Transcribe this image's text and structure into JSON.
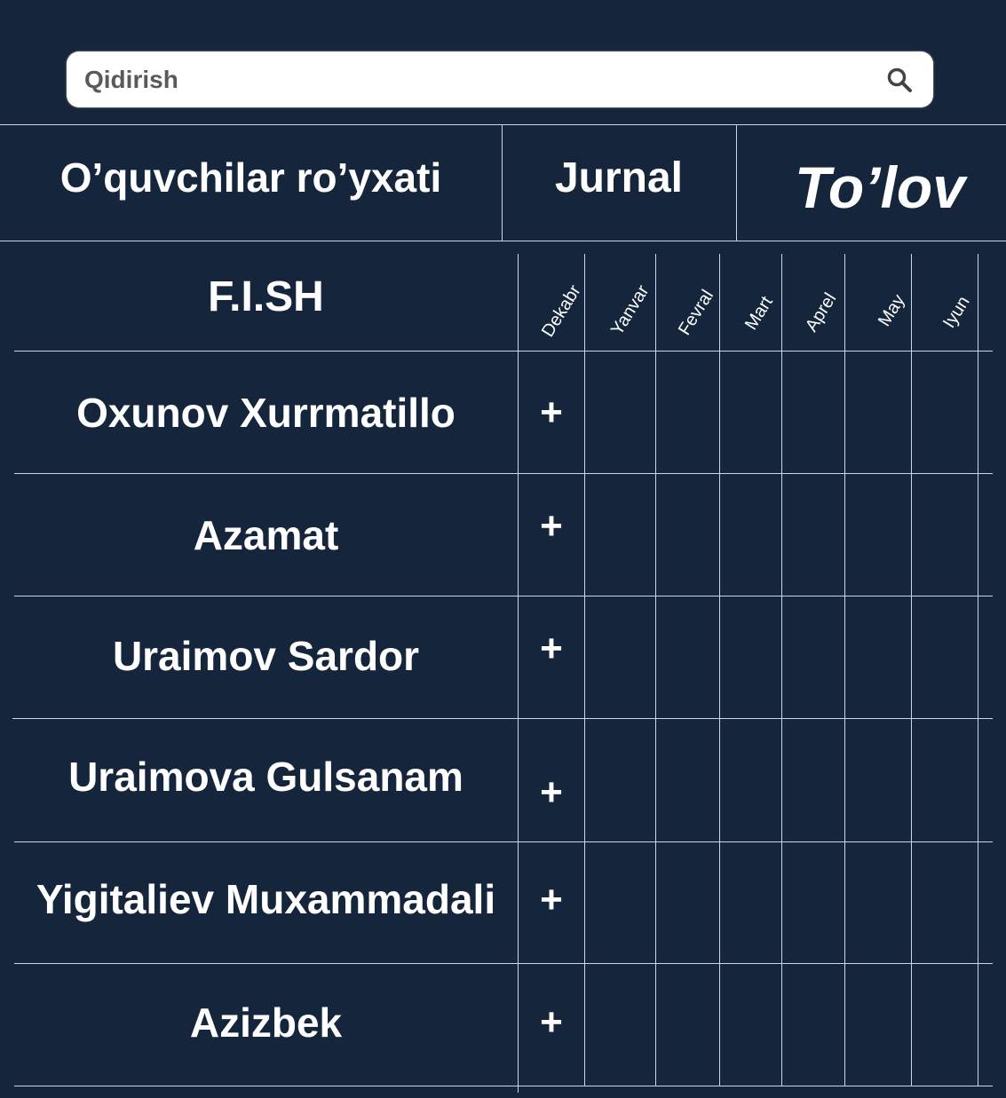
{
  "search": {
    "placeholder": "Qidirish",
    "icon": "search-icon"
  },
  "tabs": {
    "students": "O’quvchilar ro’yxati",
    "journal": "Jurnal",
    "payment": "To’lov"
  },
  "table": {
    "name_header": "F.I.SH",
    "months": [
      "Dekabr",
      "Yanvar",
      "Fevral",
      "Mart",
      "Aprel",
      "May",
      "Iyun"
    ],
    "rows": [
      {
        "name": "Oxunov Xurrmatillo",
        "dekabr": "+"
      },
      {
        "name": "Azamat",
        "dekabr": "+"
      },
      {
        "name": "Uraimov Sardor",
        "dekabr": "+"
      },
      {
        "name": "Uraimova Gulsanam",
        "dekabr": "+"
      },
      {
        "name": "Yigitaliev Muxammadali",
        "dekabr": "+"
      },
      {
        "name": "Azizbek",
        "dekabr": "+"
      }
    ]
  },
  "colors": {
    "background": "#15263c",
    "text": "#ffffff",
    "lines": "#cfd6df"
  }
}
